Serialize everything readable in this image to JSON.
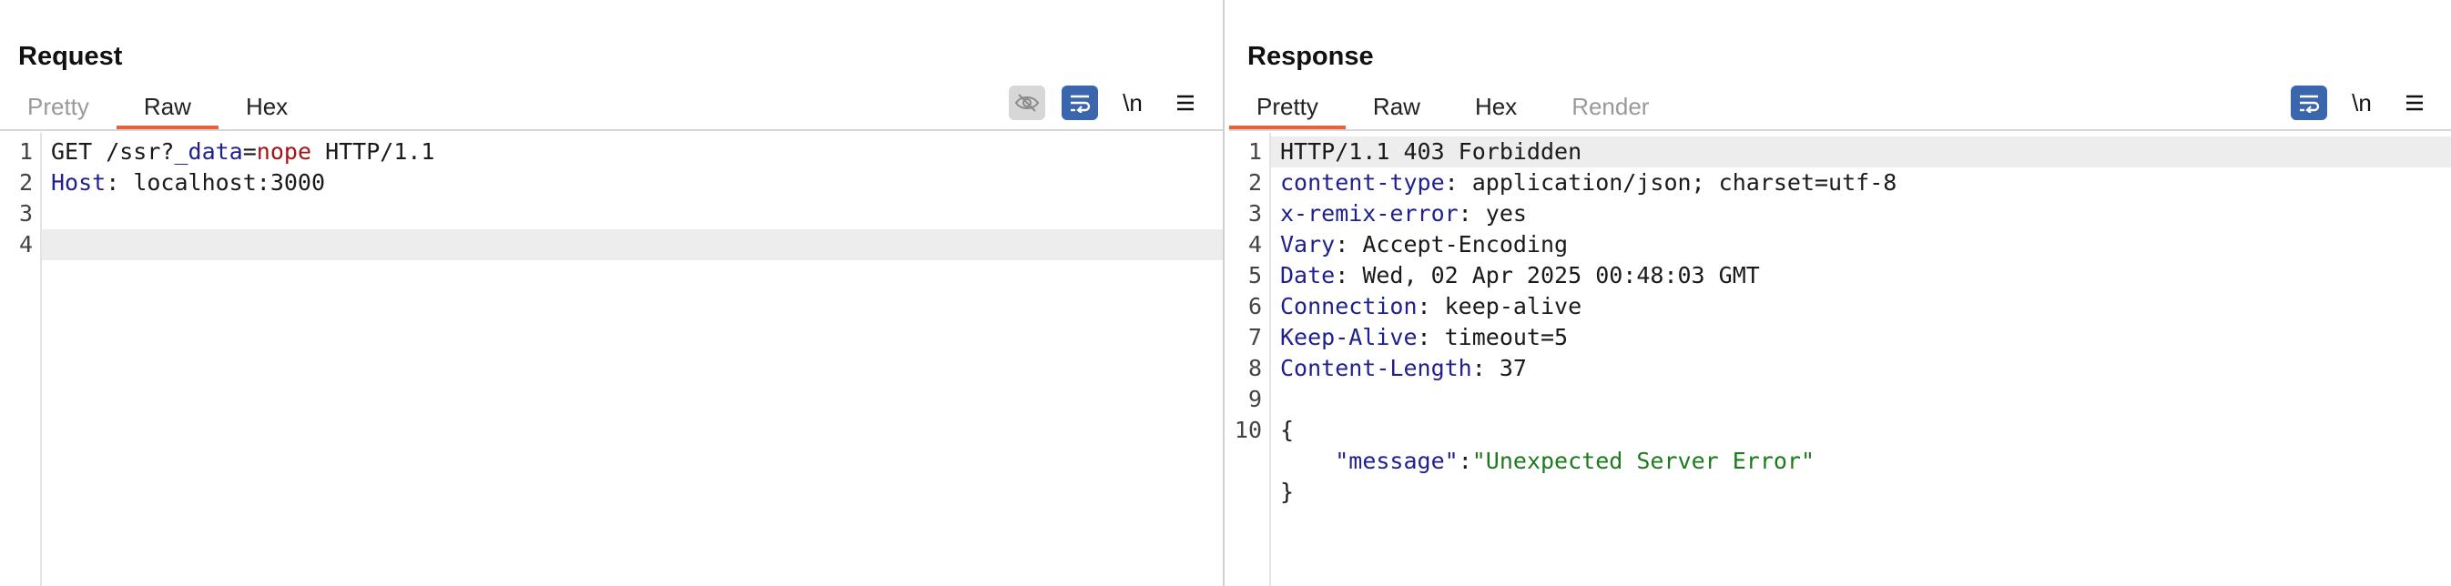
{
  "request": {
    "title": "Request",
    "tabs": [
      {
        "label": "Pretty",
        "active": false,
        "muted": true
      },
      {
        "label": "Raw",
        "active": true,
        "muted": false
      },
      {
        "label": "Hex",
        "active": false,
        "muted": false
      }
    ],
    "newline_label": "\\n",
    "lines": [
      {
        "n": "1",
        "parts": [
          {
            "t": "GET /ssr?",
            "c": "v"
          },
          {
            "t": "_data",
            "c": "k"
          },
          {
            "t": "=",
            "c": "v"
          },
          {
            "t": "nope",
            "c": "red"
          },
          {
            "t": " HTTP/1.1",
            "c": "v"
          }
        ]
      },
      {
        "n": "2",
        "parts": [
          {
            "t": "Host",
            "c": "k"
          },
          {
            "t": ": localhost:3000",
            "c": "v"
          }
        ]
      },
      {
        "n": "3",
        "parts": []
      },
      {
        "n": "4",
        "parts": [],
        "highlight": true
      }
    ]
  },
  "response": {
    "title": "Response",
    "tabs": [
      {
        "label": "Pretty",
        "active": true,
        "muted": false
      },
      {
        "label": "Raw",
        "active": false,
        "muted": false
      },
      {
        "label": "Hex",
        "active": false,
        "muted": false
      },
      {
        "label": "Render",
        "active": false,
        "muted": true
      }
    ],
    "newline_label": "\\n",
    "lines": [
      {
        "n": "1",
        "parts": [
          {
            "t": "HTTP/1.1 403 Forbidden",
            "c": "v"
          }
        ],
        "highlight": true
      },
      {
        "n": "2",
        "parts": [
          {
            "t": "content-type",
            "c": "k"
          },
          {
            "t": ": application/json; charset=utf-8",
            "c": "v"
          }
        ]
      },
      {
        "n": "3",
        "parts": [
          {
            "t": "x-remix-error",
            "c": "k"
          },
          {
            "t": ": yes",
            "c": "v"
          }
        ]
      },
      {
        "n": "4",
        "parts": [
          {
            "t": "Vary",
            "c": "k"
          },
          {
            "t": ": Accept-Encoding",
            "c": "v"
          }
        ]
      },
      {
        "n": "5",
        "parts": [
          {
            "t": "Date",
            "c": "k"
          },
          {
            "t": ": Wed, 02 Apr 2025 00:48:03 GMT",
            "c": "v"
          }
        ]
      },
      {
        "n": "6",
        "parts": [
          {
            "t": "Connection",
            "c": "k"
          },
          {
            "t": ": keep-alive",
            "c": "v"
          }
        ]
      },
      {
        "n": "7",
        "parts": [
          {
            "t": "Keep-Alive",
            "c": "k"
          },
          {
            "t": ": timeout=5",
            "c": "v"
          }
        ]
      },
      {
        "n": "8",
        "parts": [
          {
            "t": "Content-Length",
            "c": "k"
          },
          {
            "t": ": 37",
            "c": "v"
          }
        ]
      },
      {
        "n": "9",
        "parts": []
      },
      {
        "n": "10",
        "parts": [
          {
            "t": "{",
            "c": "v"
          }
        ]
      },
      {
        "n": "",
        "parts": [
          {
            "t": "    ",
            "c": "v"
          },
          {
            "t": "\"message\"",
            "c": "kw"
          },
          {
            "t": ":",
            "c": "v"
          },
          {
            "t": "\"Unexpected Server Error\"",
            "c": "str"
          }
        ]
      },
      {
        "n": "",
        "parts": [
          {
            "t": "}",
            "c": "v"
          }
        ]
      }
    ]
  },
  "colors": {
    "accent": "#e8613c",
    "button_blue": "#3a66ad",
    "key_blue": "#1f1f8f",
    "value_red": "#a31515",
    "string_green": "#1d7a1d"
  }
}
